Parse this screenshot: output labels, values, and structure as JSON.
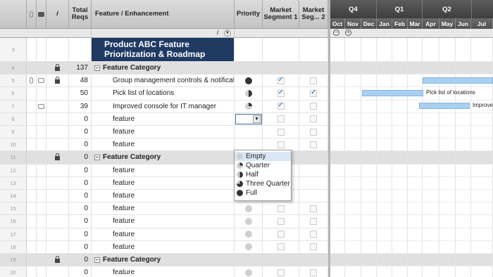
{
  "headers": {
    "total_reqs": "Total Reqs",
    "feature": "Feature / Enhancement",
    "priority": "Priority",
    "ms1": "Market Segment 1",
    "ms2": "Market Seg... 2",
    "info_glyph": "i"
  },
  "title_row": {
    "num": "3",
    "line1": "Product ABC Feature",
    "line2": "Prioritization & Roadmap"
  },
  "rows": [
    {
      "num": "4",
      "type": "cat",
      "lock": true,
      "total": "137",
      "feature": "Feature Category"
    },
    {
      "num": "5",
      "type": "item",
      "clip": true,
      "comment": true,
      "lock": true,
      "total": "48",
      "feature": "Group management controls & notificat",
      "priority": "full",
      "ms1": true,
      "ms2": false
    },
    {
      "num": "6",
      "type": "item",
      "total": "50",
      "feature": "Pick list of locations",
      "priority": "half",
      "ms1": true,
      "ms2": true
    },
    {
      "num": "7",
      "type": "item",
      "comment": true,
      "total": "39",
      "feature": "Improved console for IT manager",
      "priority": "q",
      "ms1": true,
      "ms2": false
    },
    {
      "num": "8",
      "type": "item",
      "total": "0",
      "feature": "feature",
      "selected": true,
      "ms1": false,
      "ms2": false
    },
    {
      "num": "9",
      "type": "item",
      "total": "0",
      "feature": "feature",
      "ms1": false,
      "ms2": false
    },
    {
      "num": "10",
      "type": "item",
      "total": "0",
      "feature": "feature",
      "ms1": false,
      "ms2": false
    },
    {
      "num": "11",
      "type": "cat",
      "lock": true,
      "total": "0",
      "feature": "Feature Category"
    },
    {
      "num": "12",
      "type": "item",
      "total": "0",
      "feature": "feature"
    },
    {
      "num": "13",
      "type": "item",
      "total": "0",
      "feature": "feature"
    },
    {
      "num": "14",
      "type": "item",
      "total": "0",
      "feature": "feature"
    },
    {
      "num": "15",
      "type": "item",
      "total": "0",
      "feature": "feature",
      "priority": "empty",
      "ms1": false,
      "ms2": false
    },
    {
      "num": "16",
      "type": "item",
      "total": "0",
      "feature": "feature",
      "priority": "empty",
      "ms1": false,
      "ms2": false
    },
    {
      "num": "17",
      "type": "item",
      "total": "0",
      "feature": "feature",
      "priority": "empty",
      "ms1": false,
      "ms2": false
    },
    {
      "num": "18",
      "type": "item",
      "total": "0",
      "feature": "feature",
      "priority": "empty",
      "ms1": false,
      "ms2": false
    },
    {
      "num": "19",
      "type": "cat",
      "lock": true,
      "total": "0",
      "feature": "Feature Category"
    },
    {
      "num": "20",
      "type": "item",
      "total": "0",
      "feature": "feature",
      "priority": "empty",
      "ms1": false,
      "ms2": false
    }
  ],
  "dropdown": {
    "options": [
      {
        "label": "Empty",
        "icon": "empty",
        "highlighted": true
      },
      {
        "label": "Quarter",
        "icon": "q"
      },
      {
        "label": "Half",
        "icon": "half"
      },
      {
        "label": "Three Quarter",
        "icon": "3q"
      },
      {
        "label": "Full",
        "icon": "full"
      }
    ]
  },
  "gantt": {
    "quarters": [
      "Q4",
      "Q1",
      "Q2"
    ],
    "months": [
      "Oct",
      "Nov",
      "Dec",
      "Jan",
      "Feb",
      "Mar",
      "Apr",
      "May",
      "Jun",
      "Jul"
    ],
    "bar_labels": {
      "row5": "",
      "row6": "Pick list of locations",
      "row7": "Improve"
    }
  }
}
